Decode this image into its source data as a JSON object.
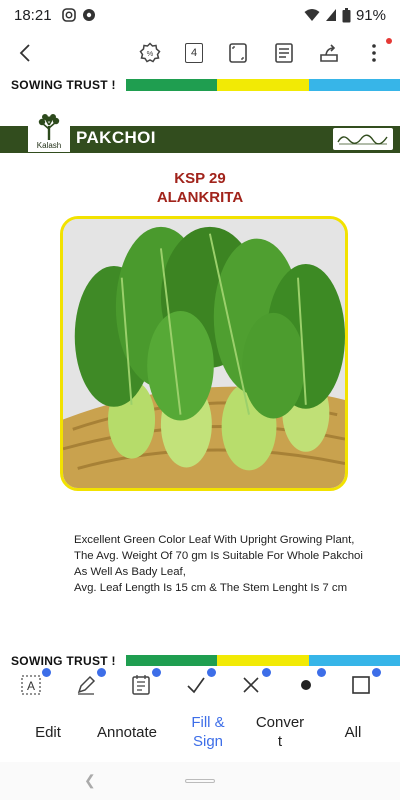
{
  "status_bar": {
    "time": "18:21",
    "battery": "91%",
    "icons": [
      "instagram-icon",
      "settings-icon",
      "wifi-icon",
      "signal-icon",
      "battery-icon"
    ]
  },
  "toolbar": {
    "page_count": "4",
    "icons": [
      "back-arrow-icon",
      "discount-icon",
      "page-count-icon",
      "crop-icon",
      "document-view-icon",
      "share-icon",
      "more-icon"
    ]
  },
  "document": {
    "trust_text": "SOWING TRUST !",
    "trust_text_bottom": "SOWING TRUST !",
    "stripe_colors": [
      "#1f9e50",
      "#f2ea05",
      "#37b5e8"
    ],
    "logo_text": "Kalash",
    "product_name": "PAKCHOI",
    "variety_code": "KSP 29",
    "variety_name": "ALANKRITA",
    "description": [
      "Excellent Green Color Leaf With Upright Growing Plant,",
      "The Avg. Weight Of 70 gm Is Suitable For Whole Pakchoi",
      "As Well As Bady Leaf,",
      "Avg. Leaf Length Is 15 cm & The Stem Lenght Is 7 cm"
    ]
  },
  "tools": {
    "icons": [
      "text-box-icon",
      "annotate-pen-icon",
      "form-icon",
      "checkmark-icon",
      "cross-icon",
      "dot-icon",
      "square-icon"
    ]
  },
  "tabs": [
    {
      "label": "Edit"
    },
    {
      "label": "Annotate"
    },
    {
      "label": "Fill &\nSign"
    },
    {
      "label": "Conver\nt"
    },
    {
      "label": "All"
    }
  ],
  "colors": {
    "accent": "#3d6ee8",
    "header_green": "#324d1e",
    "title_red": "#a1231b",
    "frame_yellow": "#f2e200"
  }
}
